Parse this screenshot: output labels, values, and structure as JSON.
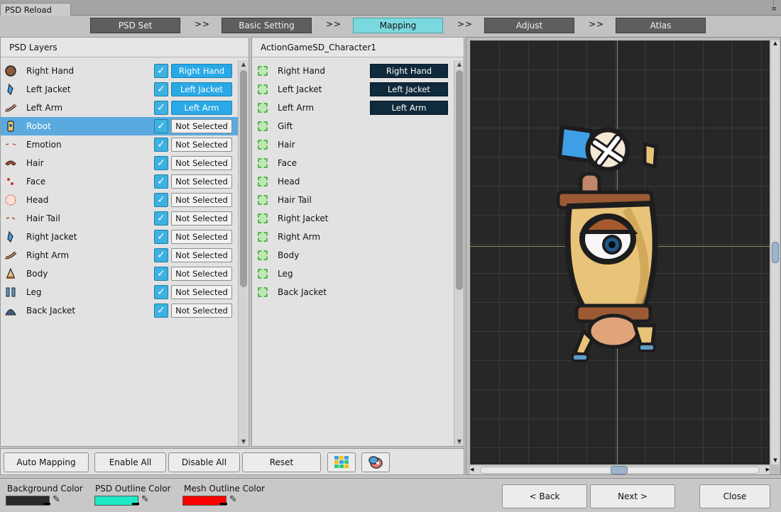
{
  "window": {
    "title": "PSD Reload"
  },
  "steps": [
    {
      "label": "PSD Set"
    },
    {
      "label": "Basic Setting"
    },
    {
      "label": "Mapping"
    },
    {
      "label": "Adjust"
    },
    {
      "label": "Atlas"
    }
  ],
  "step_separator": ">>",
  "active_step": "Mapping",
  "psd_panel": {
    "title": "PSD Layers",
    "layers": [
      {
        "name": "Right Hand",
        "checked": true,
        "mapping": "Right Hand",
        "icon": "hand-sprite-icon"
      },
      {
        "name": "Left Jacket",
        "checked": true,
        "mapping": "Left Jacket",
        "icon": "jacket-sprite-icon"
      },
      {
        "name": "Left Arm",
        "checked": true,
        "mapping": "Left Arm",
        "icon": "arm-sprite-icon"
      },
      {
        "name": "Robot",
        "checked": true,
        "mapping": "Not Selected",
        "icon": "robot-sprite-icon",
        "selected": true
      },
      {
        "name": "Emotion",
        "checked": true,
        "mapping": "Not Selected",
        "icon": "emotion-sprite-icon"
      },
      {
        "name": "Hair",
        "checked": true,
        "mapping": "Not Selected",
        "icon": "hair-sprite-icon"
      },
      {
        "name": "Face",
        "checked": true,
        "mapping": "Not Selected",
        "icon": "face-sprite-icon"
      },
      {
        "name": "Head",
        "checked": true,
        "mapping": "Not Selected",
        "icon": "head-sprite-icon"
      },
      {
        "name": "Hair Tail",
        "checked": true,
        "mapping": "Not Selected",
        "icon": "hair-tail-sprite-icon"
      },
      {
        "name": "Right Jacket",
        "checked": true,
        "mapping": "Not Selected",
        "icon": "jacket-sprite-icon"
      },
      {
        "name": "Right Arm",
        "checked": true,
        "mapping": "Not Selected",
        "icon": "arm-sprite-icon"
      },
      {
        "name": "Body",
        "checked": true,
        "mapping": "Not Selected",
        "icon": "body-sprite-icon"
      },
      {
        "name": "Leg",
        "checked": true,
        "mapping": "Not Selected",
        "icon": "leg-sprite-icon"
      },
      {
        "name": "Back Jacket",
        "checked": true,
        "mapping": "Not Selected",
        "icon": "back-jacket-sprite-icon"
      }
    ]
  },
  "mesh_panel": {
    "title": "ActionGameSD_Character1",
    "meshes": [
      {
        "name": "Right Hand",
        "mapped_to": "Right Hand"
      },
      {
        "name": "Left Jacket",
        "mapped_to": "Left Jacket"
      },
      {
        "name": "Left Arm",
        "mapped_to": "Left Arm"
      },
      {
        "name": "Gift",
        "mapped_to": ""
      },
      {
        "name": "Hair",
        "mapped_to": ""
      },
      {
        "name": "Face",
        "mapped_to": ""
      },
      {
        "name": "Head",
        "mapped_to": ""
      },
      {
        "name": "Hair Tail",
        "mapped_to": ""
      },
      {
        "name": "Right Jacket",
        "mapped_to": ""
      },
      {
        "name": "Right Arm",
        "mapped_to": ""
      },
      {
        "name": "Body",
        "mapped_to": ""
      },
      {
        "name": "Leg",
        "mapped_to": ""
      },
      {
        "name": "Back Jacket",
        "mapped_to": ""
      }
    ]
  },
  "actions": {
    "auto_mapping": "Auto Mapping",
    "enable_all": "Enable All",
    "disable_all": "Disable All",
    "reset": "Reset",
    "grid_view_icon": "grid-view-icon",
    "preview_icon": "character-preview-icon"
  },
  "colors": {
    "background_label": "Background Color",
    "background_value": "#2b2b2b",
    "psd_outline_label": "PSD Outline Color",
    "psd_outline_value": "#1de9c4",
    "mesh_outline_label": "Mesh Outline Color",
    "mesh_outline_value": "#ff0000",
    "dropper_icon": "eyedropper-icon"
  },
  "footer": {
    "back": "< Back",
    "next": "Next >",
    "close": "Close"
  },
  "theme": {
    "mapped_button": "#29a9e6",
    "selected_row": "#5aaadf",
    "active_step": "#7ad9de",
    "mesh_target": "#0f2a3c"
  }
}
